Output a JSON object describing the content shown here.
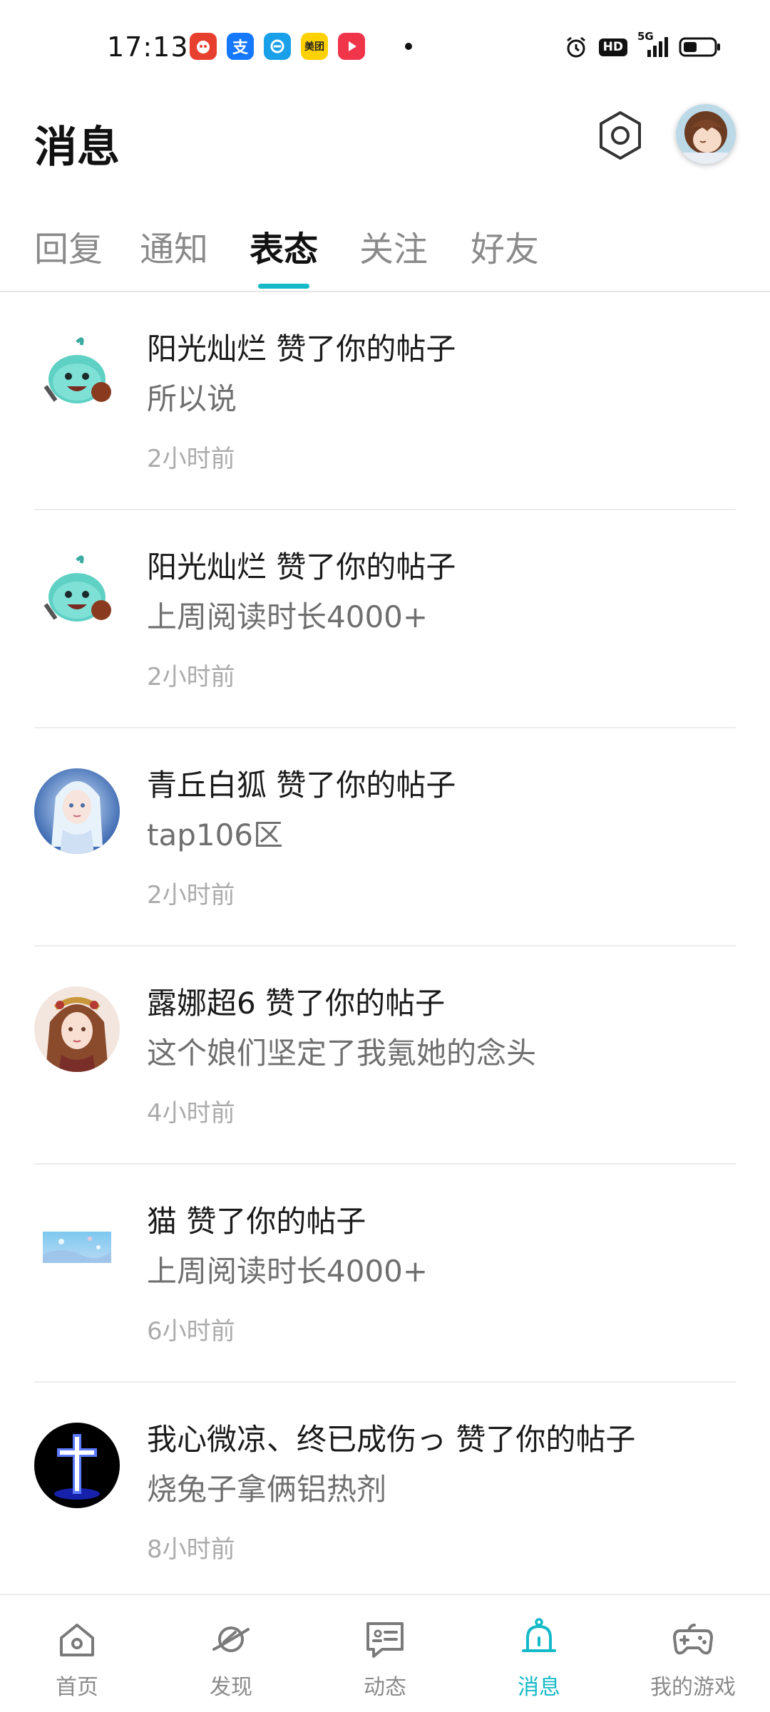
{
  "status_bar": {
    "time": "17:13",
    "notification_apps": [
      "app-icon-red",
      "alipay-icon",
      "browser-icon",
      "meituan-icon",
      "video-icon"
    ],
    "meituan_label": "美团",
    "alipay_label": "支",
    "network": "5G",
    "hd_label": "HD"
  },
  "header": {
    "title": "消息"
  },
  "tabs": [
    {
      "label": "回复"
    },
    {
      "label": "通知"
    },
    {
      "label": "表态"
    },
    {
      "label": "关注"
    },
    {
      "label": "好友"
    }
  ],
  "active_tab": 2,
  "messages": [
    {
      "title": "阳光灿烂 赞了你的帖子",
      "content": "所以说",
      "time": "2小时前",
      "avatar": "slime-avatar"
    },
    {
      "title": "阳光灿烂 赞了你的帖子",
      "content": "上周阅读时长4000+",
      "time": "2小时前",
      "avatar": "slime-avatar"
    },
    {
      "title": "青丘白狐 赞了你的帖子",
      "content": "tap106区",
      "time": "2小时前",
      "avatar": "fairy-avatar"
    },
    {
      "title": "露娜超6 赞了你的帖子",
      "content": "这个娘们坚定了我氪她的念头",
      "time": "4小时前",
      "avatar": "princess-avatar"
    },
    {
      "title": "猫 赞了你的帖子",
      "content": "上周阅读时长4000+",
      "time": "6小时前",
      "avatar": "landscape-avatar"
    },
    {
      "title": "我心微凉、终已成伤っ 赞了你的帖子",
      "content": "烧兔子拿俩铝热剂",
      "time": "8小时前",
      "avatar": "cross-avatar"
    }
  ],
  "bottom_nav": [
    {
      "label": "首页",
      "icon": "home-icon"
    },
    {
      "label": "发现",
      "icon": "planet-icon"
    },
    {
      "label": "动态",
      "icon": "chat-card-icon"
    },
    {
      "label": "消息",
      "icon": "bell-icon"
    },
    {
      "label": "我的游戏",
      "icon": "gamepad-icon"
    }
  ],
  "colors": {
    "accent": "#14b9c8",
    "text_primary": "#1a1a1a",
    "text_secondary": "#6f6f6f",
    "text_muted": "#ababab"
  }
}
